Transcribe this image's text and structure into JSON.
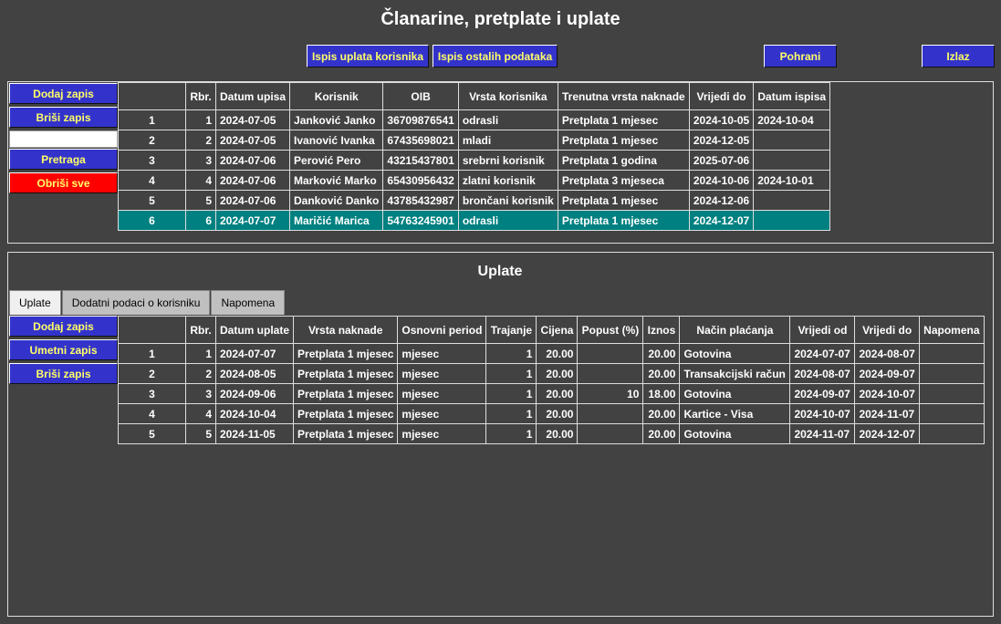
{
  "title": "Članarine, pretplate i uplate",
  "toolbar": {
    "print_payments": "Ispis uplata korisnika",
    "print_other": "Ispis ostalih podataka",
    "save": "Pohrani",
    "exit": "Izlaz"
  },
  "members": {
    "buttons": {
      "add": "Dodaj zapis",
      "delete": "Briši zapis",
      "search": "Pretraga",
      "clear_all": "Obriši sve"
    },
    "search_value": "",
    "columns": [
      "",
      "Rbr.",
      "Datum upisa",
      "Korisnik",
      "OIB",
      "Vrsta korisnika",
      "Trenutna vrsta naknade",
      "Vrijedi do",
      "Datum ispisa"
    ],
    "rows": [
      [
        "1",
        "1",
        "2024-07-05",
        "Janković Janko",
        "36709876541",
        "odrasli",
        "Pretplata 1 mjesec",
        "2024-10-05",
        "2024-10-04"
      ],
      [
        "2",
        "2",
        "2024-07-05",
        "Ivanović Ivanka",
        "67435698021",
        "mladi",
        "Pretplata 1 mjesec",
        "2024-12-05",
        ""
      ],
      [
        "3",
        "3",
        "2024-07-06",
        "Perović Pero",
        "43215437801",
        "srebrni korisnik",
        "Pretplata 1 godina",
        "2025-07-06",
        ""
      ],
      [
        "4",
        "4",
        "2024-07-06",
        "Marković Marko",
        "65430956432",
        "zlatni korisnik",
        "Pretplata 3 mjeseca",
        "2024-10-06",
        "2024-10-01"
      ],
      [
        "5",
        "5",
        "2024-07-06",
        "Danković Danko",
        "43785432987",
        "brončani korisnik",
        "Pretplata 1 mjesec",
        "2024-12-06",
        ""
      ],
      [
        "6",
        "6",
        "2024-07-07",
        "Maričić Marica",
        "54763245901",
        "odrasli",
        "Pretplata 1 mjesec",
        "2024-12-07",
        ""
      ]
    ],
    "selected_row": 5
  },
  "payments": {
    "title": "Uplate",
    "tabs": [
      "Uplate",
      "Dodatni podaci o korisniku",
      "Napomena"
    ],
    "active_tab": 0,
    "buttons": {
      "add": "Dodaj zapis",
      "insert": "Umetni zapis",
      "delete": "Briši zapis"
    },
    "columns": [
      "",
      "Rbr.",
      "Datum uplate",
      "Vrsta naknade",
      "Osnovni period",
      "Trajanje",
      "Cijena",
      "Popust (%)",
      "Iznos",
      "Način plaćanja",
      "Vrijedi od",
      "Vrijedi do",
      "Napomena"
    ],
    "rows": [
      [
        "1",
        "1",
        "2024-07-07",
        "Pretplata 1 mjesec",
        "mjesec",
        "1",
        "20.00",
        "",
        "20.00",
        "Gotovina",
        "2024-07-07",
        "2024-08-07",
        ""
      ],
      [
        "2",
        "2",
        "2024-08-05",
        "Pretplata 1 mjesec",
        "mjesec",
        "1",
        "20.00",
        "",
        "20.00",
        "Transakcijski račun",
        "2024-08-07",
        "2024-09-07",
        ""
      ],
      [
        "3",
        "3",
        "2024-09-06",
        "Pretplata 1 mjesec",
        "mjesec",
        "1",
        "20.00",
        "10",
        "18.00",
        "Gotovina",
        "2024-09-07",
        "2024-10-07",
        ""
      ],
      [
        "4",
        "4",
        "2024-10-04",
        "Pretplata 1 mjesec",
        "mjesec",
        "1",
        "20.00",
        "",
        "20.00",
        "Kartice - Visa",
        "2024-10-07",
        "2024-11-07",
        ""
      ],
      [
        "5",
        "5",
        "2024-11-05",
        "Pretplata 1 mjesec",
        "mjesec",
        "1",
        "20.00",
        "",
        "20.00",
        "Gotovina",
        "2024-11-07",
        "2024-12-07",
        ""
      ]
    ]
  },
  "colors": {
    "background": "#424242",
    "button": "#3333cc",
    "button_text": "#ffff66",
    "danger": "#ff0000",
    "selected_row": "#008080"
  }
}
